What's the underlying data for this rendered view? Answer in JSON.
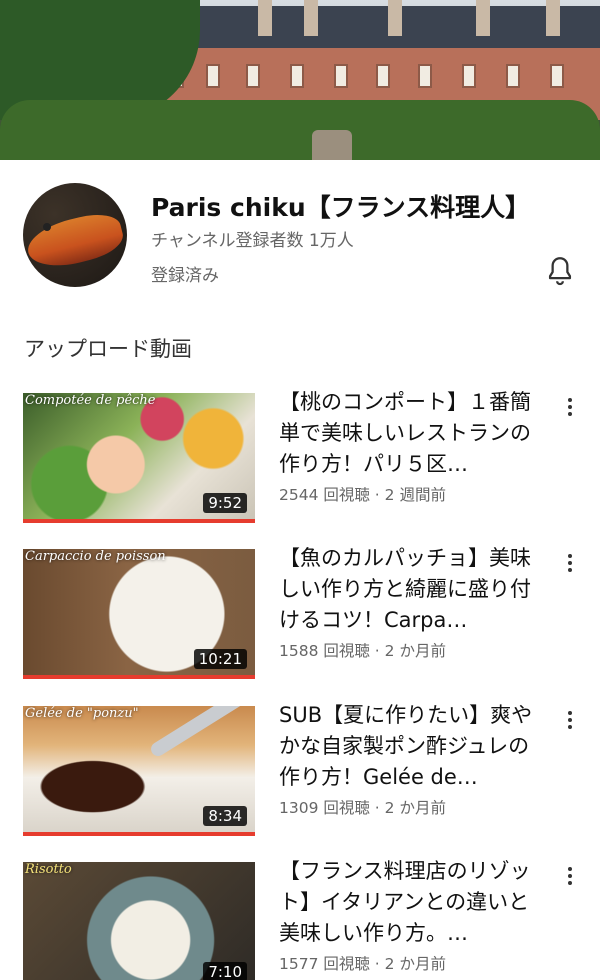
{
  "channel": {
    "name": "Paris chiku【フランス料理人】",
    "subscribers": "チャンネル登録者数 1万人",
    "status": "登録済み"
  },
  "section_title": "アップロード動画",
  "videos": [
    {
      "thumb_caption": "Compotée de pêche",
      "duration": "9:52",
      "title": "【桃のコンポート】１番簡単で美味しいレストランの作り方！パリ５区…",
      "meta": "2544 回視聴 · 2 週間前"
    },
    {
      "thumb_caption": "Carpaccio de poisson",
      "duration": "10:21",
      "title": "【魚のカルパッチョ】美味しい作り方と綺麗に盛り付けるコツ！Carpa…",
      "meta": "1588 回視聴 · 2 か月前"
    },
    {
      "thumb_caption": "Gelée de \"ponzu\"",
      "duration": "8:34",
      "title": "SUB【夏に作りたい】爽やかな自家製ポン酢ジュレの作り方！Gelée de…",
      "meta": "1309 回視聴 · 2 か月前"
    },
    {
      "thumb_caption": "Risotto",
      "duration": "7:10",
      "title": "【フランス料理店のリゾット】イタリアンとの違いと美味しい作り方。…",
      "meta": "1577 回視聴 · 2 か月前"
    }
  ],
  "icons": {
    "bell": "bell-icon",
    "more": "more-vert-icon"
  },
  "colors": {
    "progress_bar": "#e63c2e",
    "secondary_text": "#666666"
  }
}
